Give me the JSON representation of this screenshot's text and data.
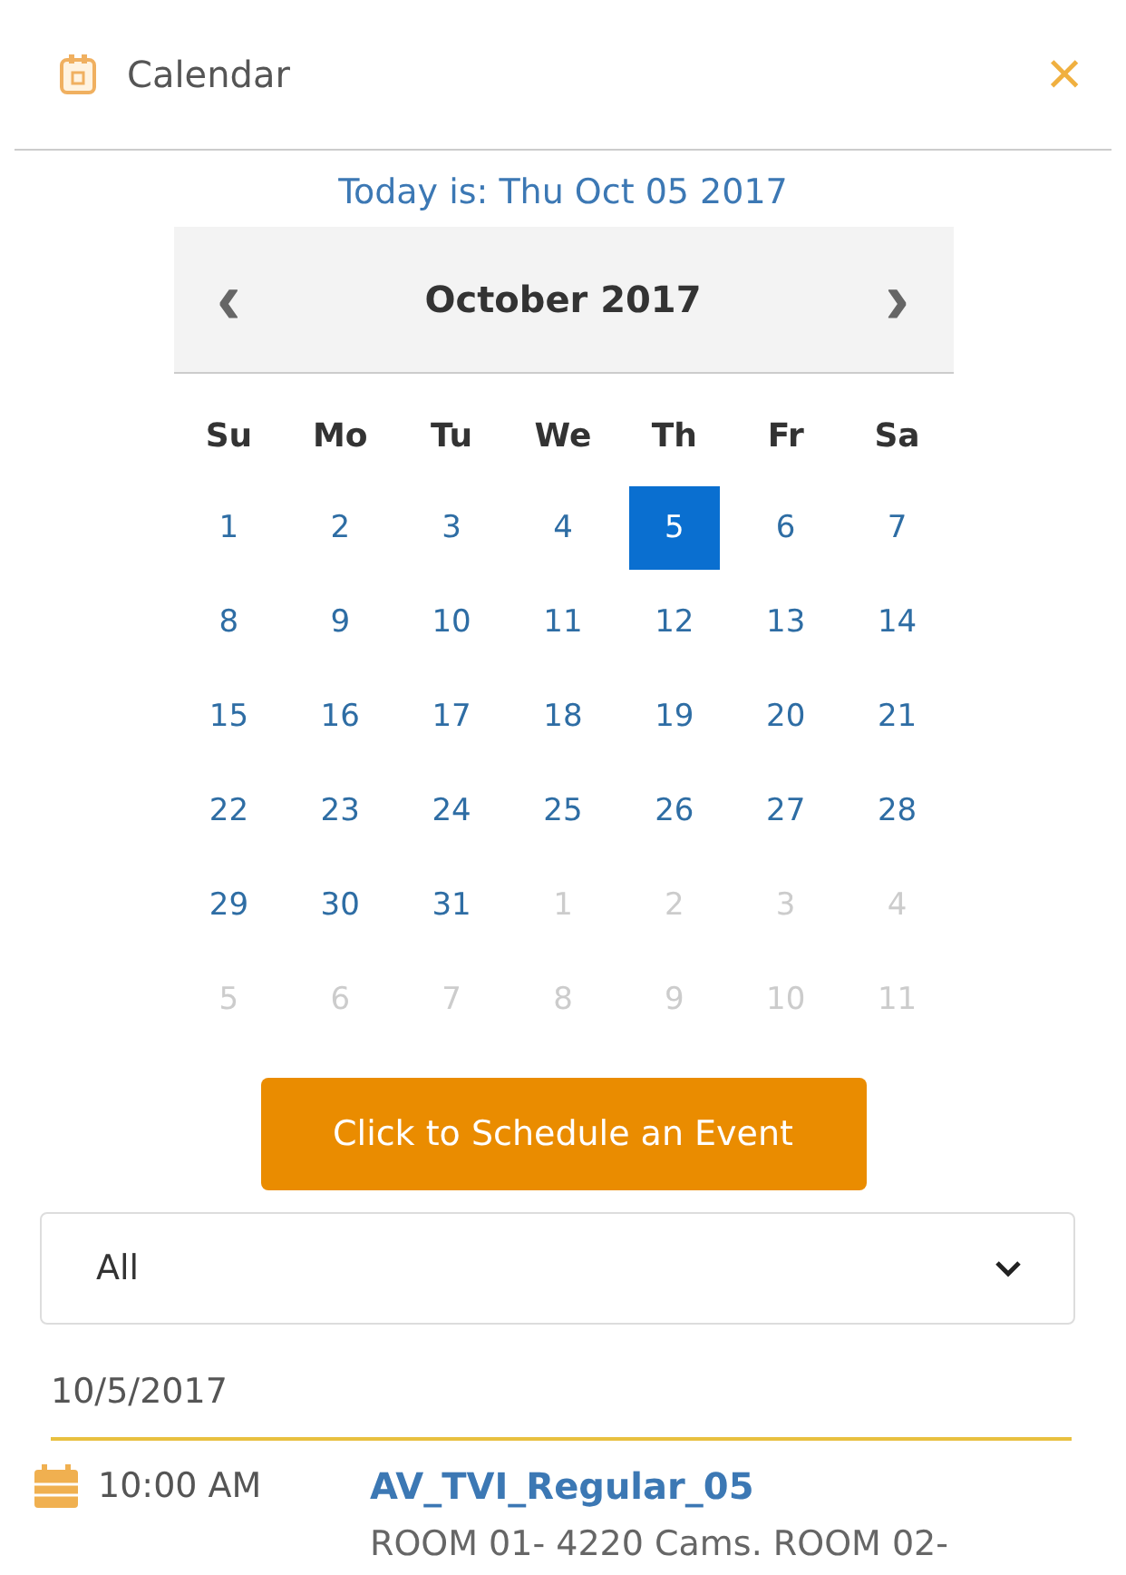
{
  "window": {
    "title": "Calendar",
    "close": "×"
  },
  "today": "Today is: Thu Oct 05 2017",
  "calendar": {
    "month": "October 2017",
    "prev": "‹",
    "next": "›",
    "weekdays": [
      "Su",
      "Mo",
      "Tu",
      "We",
      "Th",
      "Fr",
      "Sa"
    ],
    "weeks": [
      [
        {
          "day": "1",
          "muted": false,
          "selected": false
        },
        {
          "day": "2",
          "muted": false,
          "selected": false
        },
        {
          "day": "3",
          "muted": false,
          "selected": false
        },
        {
          "day": "4",
          "muted": false,
          "selected": false
        },
        {
          "day": "5",
          "muted": false,
          "selected": true
        },
        {
          "day": "6",
          "muted": false,
          "selected": false
        },
        {
          "day": "7",
          "muted": false,
          "selected": false
        }
      ],
      [
        {
          "day": "8",
          "muted": false,
          "selected": false
        },
        {
          "day": "9",
          "muted": false,
          "selected": false
        },
        {
          "day": "10",
          "muted": false,
          "selected": false
        },
        {
          "day": "11",
          "muted": false,
          "selected": false
        },
        {
          "day": "12",
          "muted": false,
          "selected": false
        },
        {
          "day": "13",
          "muted": false,
          "selected": false
        },
        {
          "day": "14",
          "muted": false,
          "selected": false
        }
      ],
      [
        {
          "day": "15",
          "muted": false,
          "selected": false
        },
        {
          "day": "16",
          "muted": false,
          "selected": false
        },
        {
          "day": "17",
          "muted": false,
          "selected": false
        },
        {
          "day": "18",
          "muted": false,
          "selected": false
        },
        {
          "day": "19",
          "muted": false,
          "selected": false
        },
        {
          "day": "20",
          "muted": false,
          "selected": false
        },
        {
          "day": "21",
          "muted": false,
          "selected": false
        }
      ],
      [
        {
          "day": "22",
          "muted": false,
          "selected": false
        },
        {
          "day": "23",
          "muted": false,
          "selected": false
        },
        {
          "day": "24",
          "muted": false,
          "selected": false
        },
        {
          "day": "25",
          "muted": false,
          "selected": false
        },
        {
          "day": "26",
          "muted": false,
          "selected": false
        },
        {
          "day": "27",
          "muted": false,
          "selected": false
        },
        {
          "day": "28",
          "muted": false,
          "selected": false
        }
      ],
      [
        {
          "day": "29",
          "muted": false,
          "selected": false
        },
        {
          "day": "30",
          "muted": false,
          "selected": false
        },
        {
          "day": "31",
          "muted": false,
          "selected": false
        },
        {
          "day": "1",
          "muted": true,
          "selected": false
        },
        {
          "day": "2",
          "muted": true,
          "selected": false
        },
        {
          "day": "3",
          "muted": true,
          "selected": false
        },
        {
          "day": "4",
          "muted": true,
          "selected": false
        }
      ],
      [
        {
          "day": "5",
          "muted": true,
          "selected": false
        },
        {
          "day": "6",
          "muted": true,
          "selected": false
        },
        {
          "day": "7",
          "muted": true,
          "selected": false
        },
        {
          "day": "8",
          "muted": true,
          "selected": false
        },
        {
          "day": "9",
          "muted": true,
          "selected": false
        },
        {
          "day": "10",
          "muted": true,
          "selected": false
        },
        {
          "day": "11",
          "muted": true,
          "selected": false
        }
      ]
    ]
  },
  "schedule_button": "Click to Schedule an Event",
  "filter": {
    "value": "All"
  },
  "date_heading": "10/5/2017",
  "events": [
    {
      "time": "10:00 AM",
      "title": "AV_TVI_Regular_05",
      "details": "ROOM 01- 4220 Cams. ROOM 02-"
    }
  ]
}
